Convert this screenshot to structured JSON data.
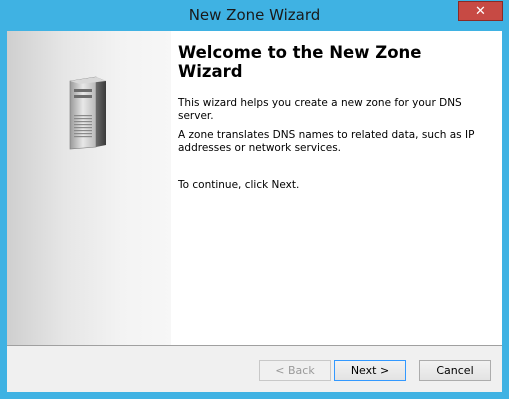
{
  "window": {
    "title": "New Zone Wizard",
    "close_label": "✕"
  },
  "content": {
    "heading": "Welcome to the New Zone Wizard",
    "paragraph1": "This wizard helps you create a new zone for your DNS server.",
    "paragraph2": "A zone translates DNS names to related data, such as IP addresses or network services.",
    "paragraph3": "To continue, click Next."
  },
  "buttons": {
    "back": "< Back",
    "next": "Next >",
    "cancel": "Cancel"
  },
  "icons": {
    "sidebar_icon": "server-icon"
  }
}
